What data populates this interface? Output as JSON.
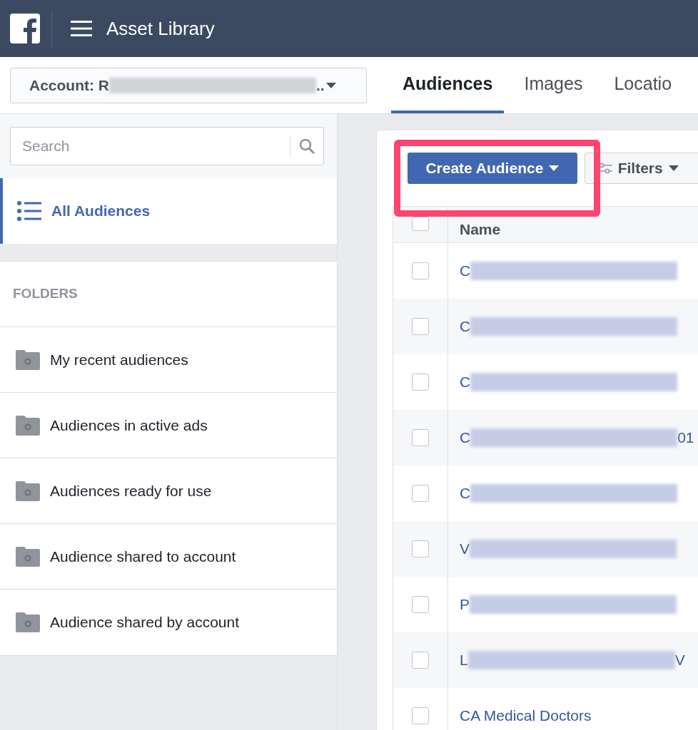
{
  "header": {
    "title": "Asset Library"
  },
  "account": {
    "label": "Account: R",
    "tail": ".."
  },
  "tabs": [
    {
      "label": "Audiences",
      "selected": true
    },
    {
      "label": "Images",
      "selected": false
    },
    {
      "label": "Locatio",
      "selected": false
    }
  ],
  "search": {
    "placeholder": "Search"
  },
  "nav": [
    {
      "label": "All Audiences",
      "selected": true
    }
  ],
  "folders": {
    "heading": "FOLDERS",
    "items": [
      {
        "label": "My recent audiences"
      },
      {
        "label": "Audiences in active ads"
      },
      {
        "label": "Audiences ready for use"
      },
      {
        "label": "Audience shared to account"
      },
      {
        "label": "Audience shared by account"
      }
    ]
  },
  "toolbar": {
    "create": "Create Audience",
    "filters": "Filters"
  },
  "table": {
    "select_all": {
      "checked": false
    },
    "columns": [
      "Name"
    ],
    "rows": [
      {
        "name": "C",
        "checked": false
      },
      {
        "name": "C",
        "checked": false
      },
      {
        "name": "C",
        "checked": false
      },
      {
        "name": "C",
        "tail": "01",
        "checked": false
      },
      {
        "name": "C",
        "checked": false
      },
      {
        "name": "V",
        "checked": false
      },
      {
        "name": "P",
        "checked": false
      },
      {
        "name": "L",
        "tail": "V",
        "checked": false
      },
      {
        "name": "CA Medical Doctors",
        "checked": false
      }
    ]
  }
}
